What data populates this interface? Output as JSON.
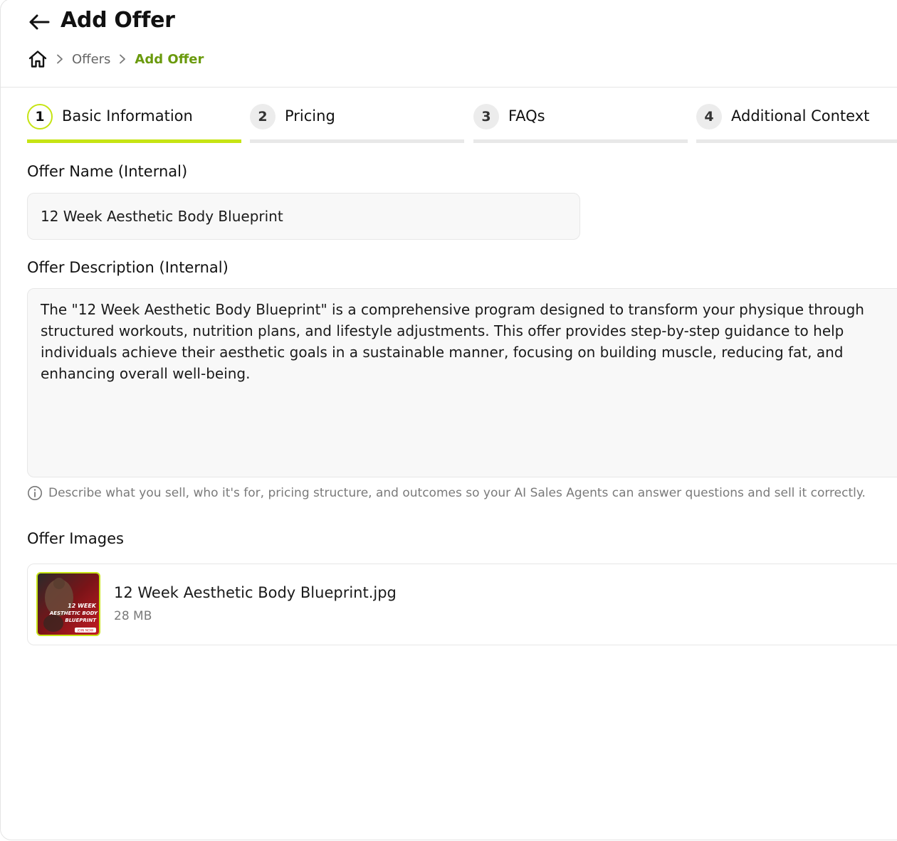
{
  "header": {
    "title": "Add Offer",
    "breadcrumb": {
      "parent": "Offers",
      "current": "Add Offer"
    }
  },
  "steps": [
    {
      "number": "1",
      "label": "Basic Information",
      "active": true
    },
    {
      "number": "2",
      "label": "Pricing",
      "active": false
    },
    {
      "number": "3",
      "label": "FAQs",
      "active": false
    },
    {
      "number": "4",
      "label": "Additional Context",
      "active": false
    }
  ],
  "form": {
    "offer_name": {
      "label": "Offer Name (Internal)",
      "value": "12 Week Aesthetic Body Blueprint"
    },
    "offer_description": {
      "label": "Offer Description (Internal)",
      "value": "The \"12 Week Aesthetic Body Blueprint\" is a comprehensive program designed to transform your physique through structured workouts, nutrition plans, and lifestyle adjustments. This offer provides step-by-step guidance to help individuals achieve their aesthetic goals in a sustainable manner, focusing on building muscle, reducing fat, and enhancing overall well-being.",
      "hint": "Describe what you sell, who it's for, pricing structure, and outcomes so your AI Sales Agents can answer questions and sell it correctly."
    },
    "offer_images": {
      "label": "Offer Images",
      "files": [
        {
          "name": "12 Week Aesthetic Body Blueprint.jpg",
          "size": "28 MB",
          "thumb_text": {
            "line1": "12 WEEK",
            "line2": "AESTHETIC BODY",
            "line3": "BLUEPRINT",
            "cta": "JOIN NOW"
          }
        }
      ]
    }
  },
  "colors": {
    "accent": "#c6e414",
    "breadcrumb_active": "#6a9a0d",
    "inactive_bar": "#e8e8e8",
    "field_bg": "#f8f8f8"
  },
  "icons": {
    "back": "arrow-left-icon",
    "home": "home-icon",
    "separator": "chevron-right-icon",
    "hint": "info-icon"
  }
}
